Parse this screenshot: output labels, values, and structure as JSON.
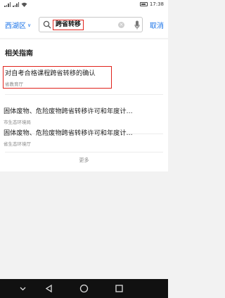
{
  "status_bar": {
    "time": "17:38"
  },
  "header": {
    "region_label": "西湖区",
    "search_query": "跨省转移",
    "cancel_label": "取消"
  },
  "section": {
    "title": "相关指南"
  },
  "results": [
    {
      "title": "对自考合格课程跨省转移的确认",
      "source": "省教育厅"
    },
    {
      "title": "固体废物、危险废物跨省转移许可和年度计…",
      "source": "市生态环境局"
    },
    {
      "title": "固体废物、危险废物跨省转移许可和年度计…",
      "source": "省生态环境厅"
    }
  ],
  "more_label": "更多",
  "icons": {
    "search": "search-icon",
    "clear": "clear-icon",
    "mic": "microphone-icon",
    "nav_back": "back-triangle-icon",
    "nav_home": "home-circle-icon",
    "nav_recent": "recent-square-icon",
    "nav_down": "chevron-down-icon"
  },
  "colors": {
    "accent": "#1a73e8",
    "highlight": "#e0221b"
  }
}
